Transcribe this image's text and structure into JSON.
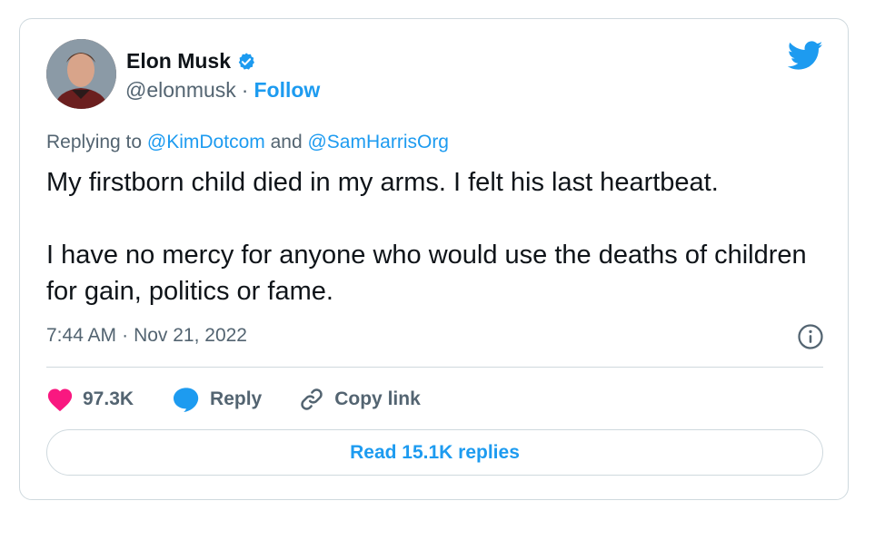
{
  "tweet": {
    "author": {
      "name": "Elon Musk",
      "handle": "@elonmusk",
      "separator": "·",
      "follow_label": "Follow"
    },
    "replying": {
      "prefix": "Replying to",
      "mention1": "@KimDotcom",
      "conjunction": "and",
      "mention2": "@SamHarrisOrg"
    },
    "text": "My firstborn child died in my arms. I felt his last heartbeat.\n\nI have no mercy for anyone who would use the deaths of children for gain, politics or fame.",
    "time": "7:44 AM",
    "time_separator": "·",
    "date": "Nov 21, 2022",
    "actions": {
      "likes": "97.3K",
      "reply": "Reply",
      "copy_link": "Copy link"
    },
    "read_replies": "Read 15.1K replies"
  },
  "colors": {
    "accent": "#1d9bf0",
    "heart": "#f91880",
    "muted": "#536471",
    "border": "#cfd9de"
  },
  "icons": [
    "verified-badge-icon",
    "twitter-bird-icon",
    "info-icon",
    "heart-icon",
    "reply-bubble-icon",
    "link-icon"
  ]
}
